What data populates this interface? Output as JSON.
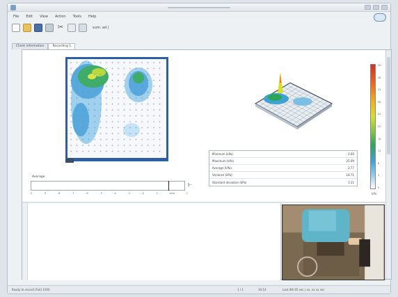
{
  "app": {
    "title": ""
  },
  "menu": {
    "items": [
      "File",
      "Edit",
      "View",
      "Action",
      "Tools",
      "Help"
    ]
  },
  "toolbar": {
    "icons": [
      "new-icon",
      "open-icon",
      "save-icon",
      "print-icon",
      "cut-icon",
      "copy-icon",
      "paste-icon"
    ],
    "label": "sum: ad |"
  },
  "tabs": [
    {
      "label": "Client information"
    },
    {
      "label": "Recording 1"
    }
  ],
  "colorbar": {
    "ticks": [
      "40",
      "36",
      "32",
      "28",
      "24",
      "20",
      "16",
      "12",
      "8",
      "4",
      "0"
    ],
    "unit": "kPa"
  },
  "stats": {
    "rows": [
      {
        "label": "Minimum (kPa)",
        "value": "0.00"
      },
      {
        "label": "Maximum (kPa)",
        "value": "25.69"
      },
      {
        "label": "Average (kPa)",
        "value": "2.77"
      },
      {
        "label": "Variance (kPa)",
        "value": "18.71"
      },
      {
        "label": "Standard deviation (kPa)",
        "value": "3.31"
      }
    ]
  },
  "average": {
    "label": "Average",
    "scale": [
      "0",
      "-9",
      "-8",
      "-7",
      "-6",
      "-5",
      "-4",
      "-3",
      "-2",
      "-1",
      "zero",
      "1"
    ]
  },
  "status": {
    "left": "Ready to record (Full) 1/0/0",
    "mid": "1 / 1",
    "time": "10:14",
    "right": "Last 4th 05 sec | xx, xx xx sec"
  },
  "colors": {
    "accent": "#6b8fb5",
    "panel": "#ffffff",
    "frame": "#eef1f4"
  }
}
